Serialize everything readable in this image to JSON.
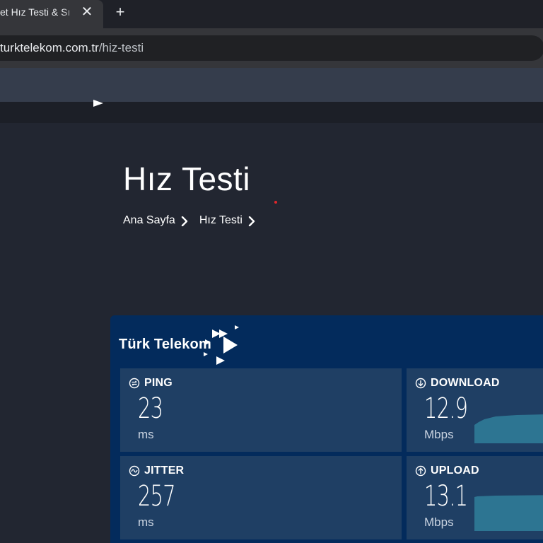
{
  "browser": {
    "tab_title": "et Hız Testi & Sı",
    "close_tab_glyph": "✕",
    "new_tab_glyph": "+",
    "url_host": "turktelekom.com.tr",
    "url_path": "/hiz-testi"
  },
  "page": {
    "title": "Hız Testi",
    "breadcrumb": [
      "Ana Sayfa",
      "Hız Testi"
    ]
  },
  "widget": {
    "brand": "Türk Telekom",
    "metrics": {
      "ping": {
        "label": "PING",
        "value": "23",
        "unit": "ms"
      },
      "jitter": {
        "label": "JITTER",
        "value": "257",
        "unit": "ms"
      },
      "download": {
        "label": "DOWNLOAD",
        "value": "12.9",
        "unit": "Mbps"
      },
      "upload": {
        "label": "UPLOAD",
        "value": "13.1",
        "unit": "Mbps"
      }
    }
  },
  "colors": {
    "page_bg": "#222631",
    "widget_bg": "#032b5c",
    "tile_bg": "#1f3f64",
    "spark_fill": "#2d7592",
    "accent_red": "#e0262b"
  },
  "icons": {
    "ping": "ping-icon",
    "jitter": "jitter-icon",
    "download": "download-arrow-icon",
    "upload": "upload-arrow-icon",
    "breadcrumb_separator": "chevron-right-icon",
    "logo": "turk-telekom-logo-icon"
  }
}
